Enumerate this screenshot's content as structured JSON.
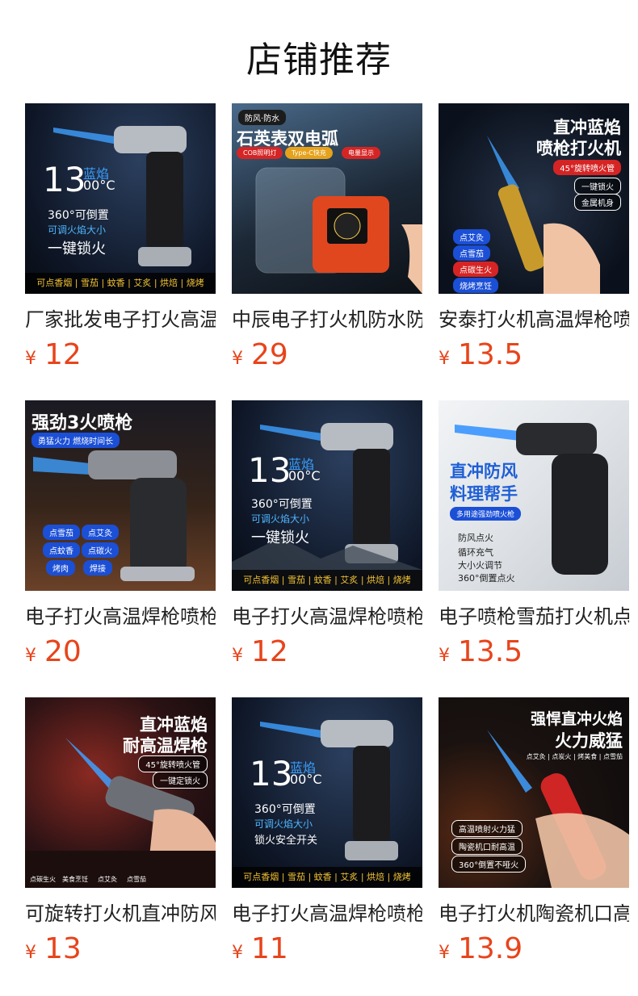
{
  "page": {
    "title": "店铺推荐"
  },
  "currency": "¥",
  "products": [
    {
      "name": "厂家批发电子打火高温",
      "price": "12",
      "image": {
        "num": "13",
        "small_a": "蓝焰",
        "small_b": "00°C",
        "line1": "360°可倒置",
        "line2": "可调火焰大小",
        "line3": "一键锁火",
        "strip": "可点香烟 | 雪茄 | 蚊香 | 艾炙 | 烘焙 | 烧烤"
      }
    },
    {
      "name": "中辰电子打火机防水防",
      "price": "29",
      "image": {
        "tag": "防风·防水",
        "headline": "石英表双电弧",
        "chip1": "COB照明灯",
        "chip2": "Type-C快充",
        "chip3": "电量显示"
      }
    },
    {
      "name": "安泰打火机高温焊枪喷",
      "price": "13.5",
      "image": {
        "headline1": "直冲蓝焰",
        "headline2": "喷枪打火机",
        "sub": "45°旋转喷火管",
        "b1": "一键锁火",
        "b2": "金属机身",
        "p1": "点艾灸",
        "p2": "点雪茄",
        "p3": "点碳生火",
        "p4": "烧烤烹饪"
      }
    },
    {
      "name": "电子打火高温焊枪喷枪",
      "price": "20",
      "image": {
        "headline": "强劲3火喷枪",
        "sub": "勇猛火力 燃烧时间长",
        "p1": "点雪茄",
        "p2": "点艾灸",
        "p3": "点蚊香",
        "p4": "点碳火",
        "p5": "烤肉",
        "p6": "焊接"
      }
    },
    {
      "name": "电子打火高温焊枪喷枪",
      "price": "12",
      "image": {
        "num": "13",
        "small_a": "蓝焰",
        "small_b": "00°C",
        "line1": "360°可倒置",
        "line2": "可调火焰大小",
        "line3": "一键锁火",
        "strip": "可点香烟 | 雪茄 | 蚊香 | 艾炙 | 烘焙 | 烧烤"
      }
    },
    {
      "name": "电子喷枪雪茄打火机点",
      "price": "13.5",
      "image": {
        "headline1": "直冲防风",
        "headline2": "料理帮手",
        "sub": "多用途强劲喷火枪",
        "f1": "防风点火",
        "f2": "循环充气",
        "f3": "大小火调节",
        "f4": "360°倒置点火"
      }
    },
    {
      "name": "可旋转打火机直冲防风",
      "price": "13",
      "image": {
        "headline1": "直冲蓝焰",
        "headline2": "耐高温焊枪",
        "sub1": "45°旋转喷火管",
        "sub2": "一键定锁火",
        "t1": "点碳生火",
        "t2": "美食烹饪",
        "t3": "点艾灸",
        "t4": "点雪茄"
      }
    },
    {
      "name": "电子打火高温焊枪喷枪",
      "price": "11",
      "image": {
        "num": "13",
        "small_a": "蓝焰",
        "small_b": "00°C",
        "line1": "360°可倒置",
        "line2": "可调火焰大小",
        "line3": "锁火安全开关",
        "strip": "可点香烟 | 雪茄 | 蚊香 | 艾炙 | 烘焙 | 烧烤"
      }
    },
    {
      "name": "电子打火机陶瓷机口高",
      "price": "13.9",
      "image": {
        "headline1": "强悍直冲火焰",
        "headline2": "火力威猛",
        "sub": "点艾灸 | 点炭火 | 烤美食 | 点雪茄",
        "b1": "高温喷射火力猛",
        "b2": "陶瓷机口耐高温",
        "b3": "360°倒置不哑火"
      }
    }
  ]
}
